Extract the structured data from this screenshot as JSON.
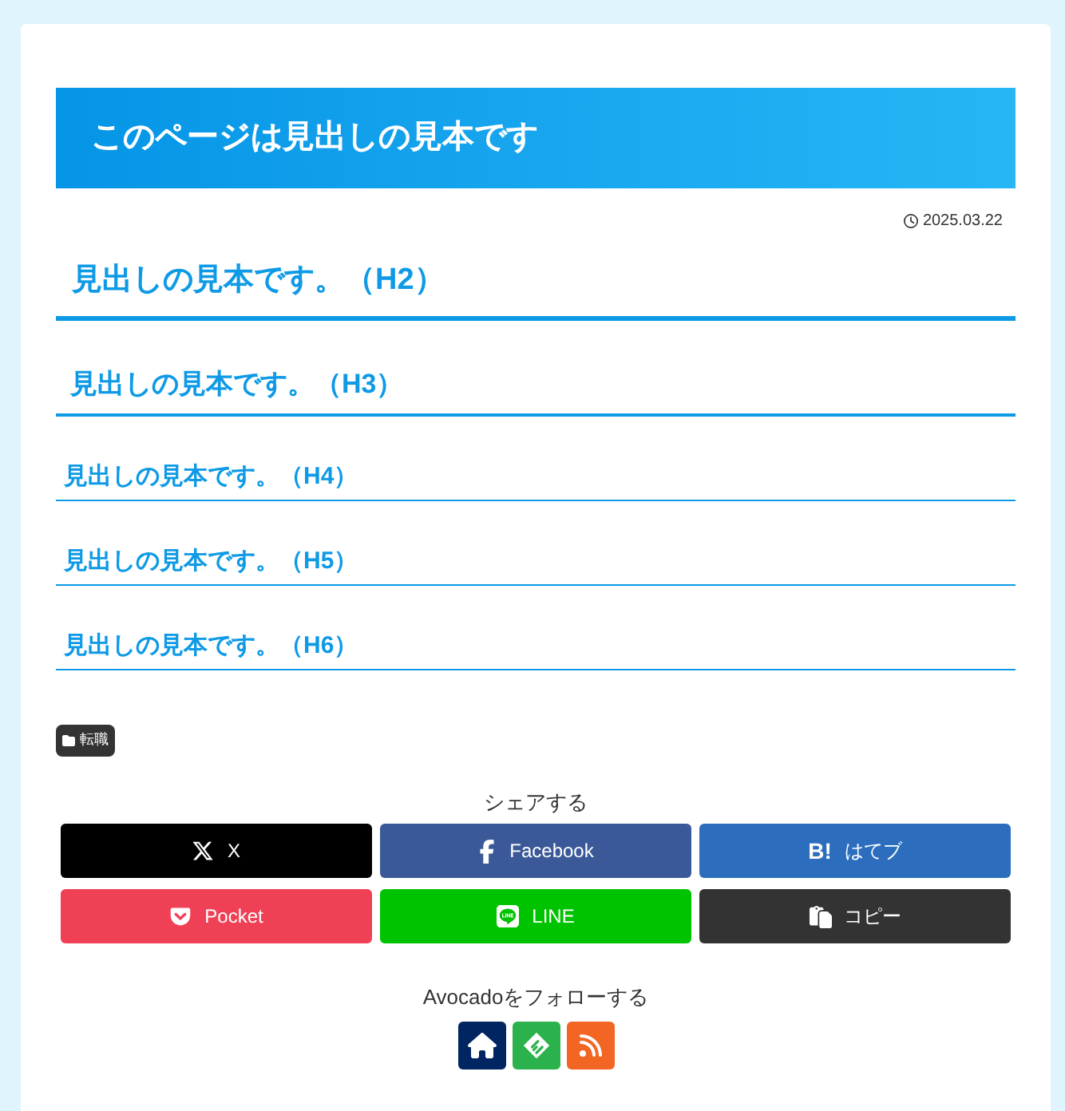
{
  "title": "このページは見出しの見本です",
  "date": "2025.03.22",
  "headings": [
    {
      "kind": "h2",
      "text": "見出しの見本です。（H2）"
    },
    {
      "kind": "h3",
      "text": "見出しの見本です。（H3）"
    },
    {
      "kind": "h4",
      "text": "見出しの見本です。（H4）"
    },
    {
      "kind": "h5",
      "text": "見出しの見本です。（H5）"
    },
    {
      "kind": "h6",
      "text": "見出しの見本です。（H6）"
    }
  ],
  "category": "転職",
  "share": {
    "label": "シェアする",
    "buttons": [
      {
        "kind": "x",
        "label": "X"
      },
      {
        "kind": "facebook",
        "label": "Facebook"
      },
      {
        "kind": "hatena",
        "label": "はてブ",
        "icon_text": "B!"
      },
      {
        "kind": "pocket",
        "label": "Pocket"
      },
      {
        "kind": "line",
        "label": "LINE"
      },
      {
        "kind": "copy",
        "label": "コピー"
      }
    ]
  },
  "follow": {
    "label": "Avocadoをフォローする",
    "buttons": [
      {
        "kind": "home"
      },
      {
        "kind": "feedly"
      },
      {
        "kind": "rss"
      }
    ]
  }
}
